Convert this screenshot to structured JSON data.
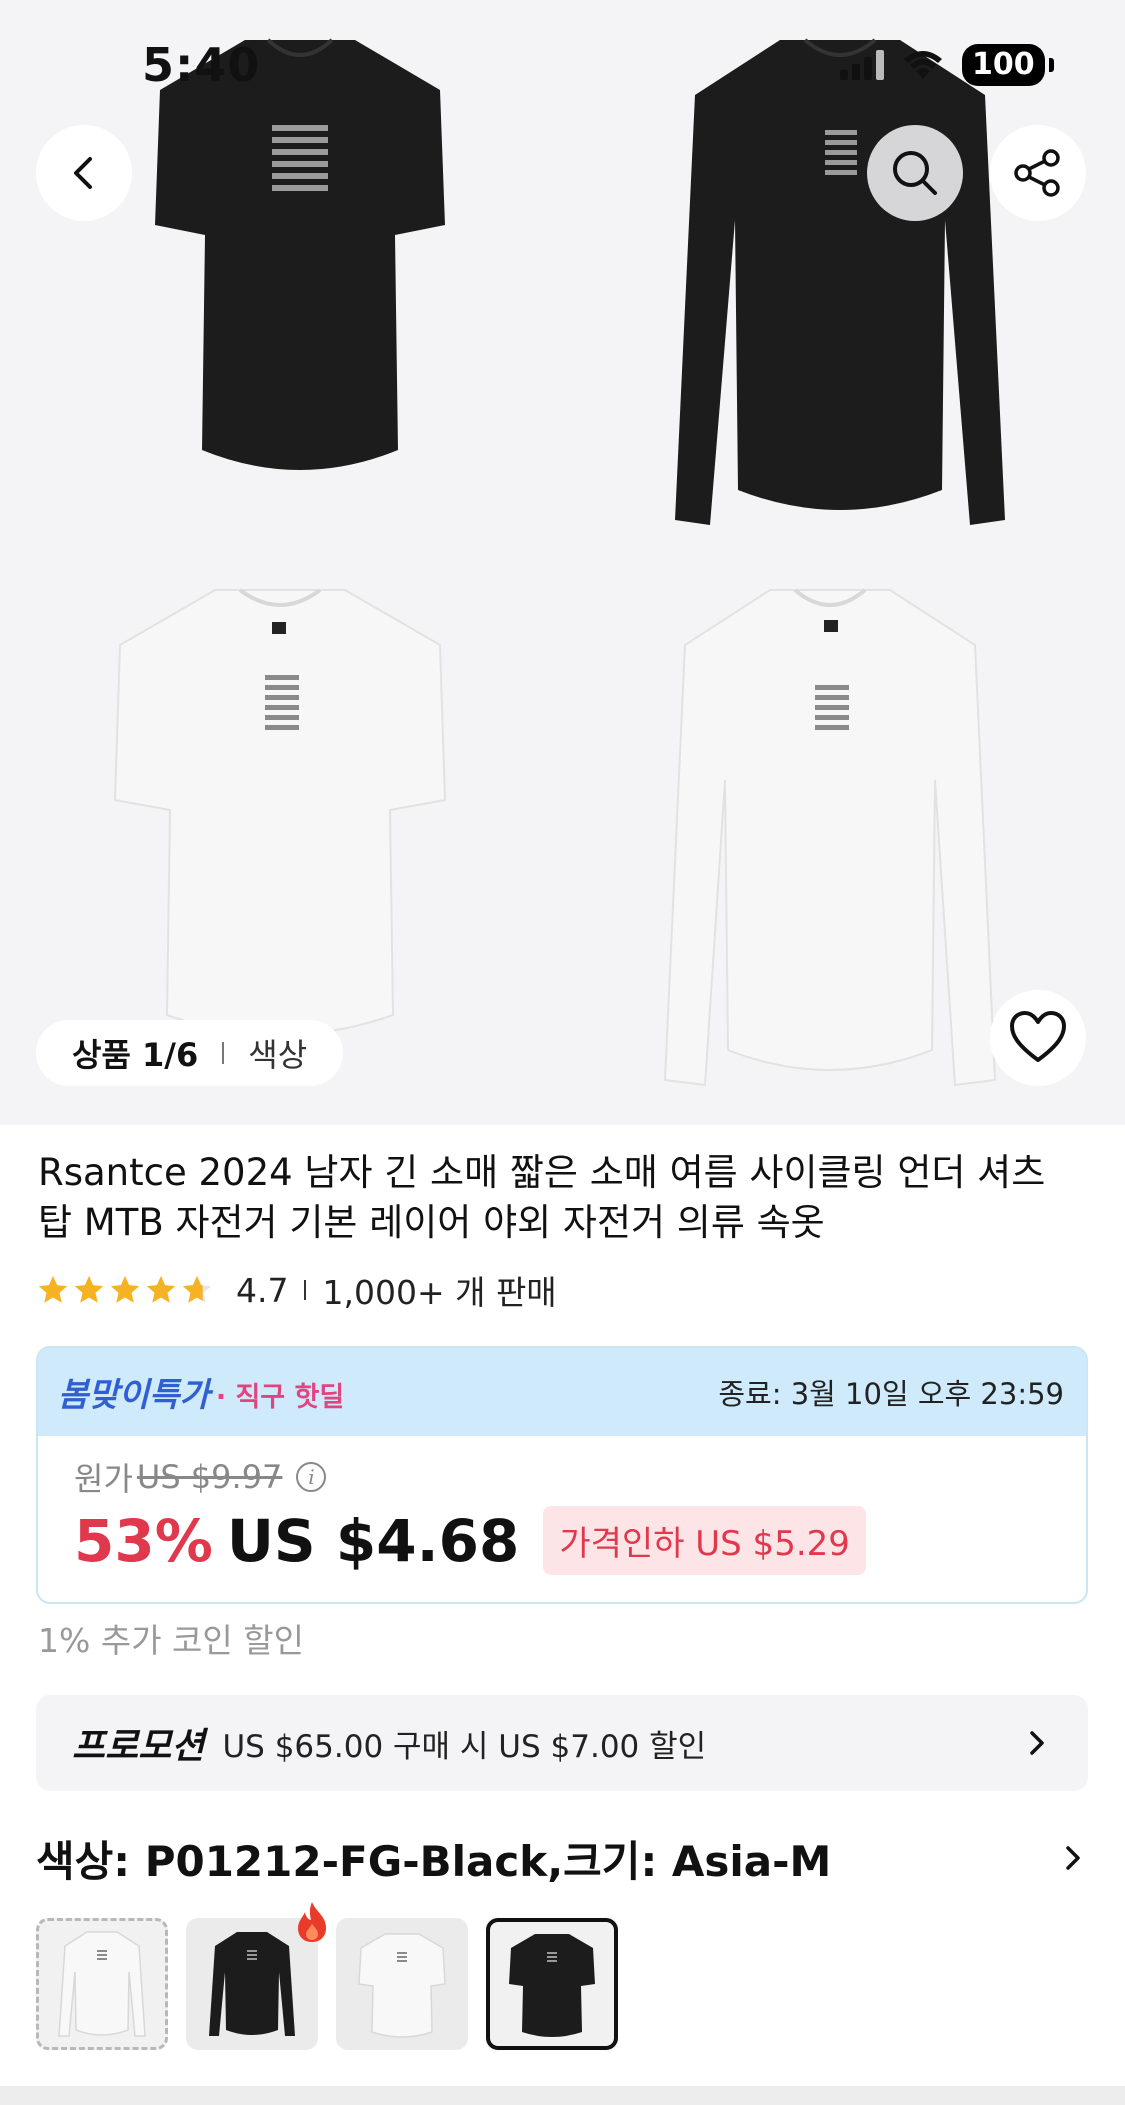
{
  "status_bar": {
    "time": "5:40",
    "battery": "100"
  },
  "gallery": {
    "counter": "상품 1/6",
    "category": "색상",
    "images": [
      {
        "name": "black short sleeve",
        "color": "#1c1c1c"
      },
      {
        "name": "black long sleeve",
        "color": "#1c1c1c"
      },
      {
        "name": "white short sleeve",
        "color": "#f7f7f7"
      },
      {
        "name": "white long sleeve",
        "color": "#f7f7f7"
      }
    ]
  },
  "icons": {
    "back": "chevron-left-icon",
    "search": "search-icon",
    "share": "share-icon",
    "wishlist": "heart-icon",
    "promo_arrow": "chevron-right-icon",
    "variant_arrow": "chevron-right-icon",
    "hot": "fire-icon"
  },
  "product": {
    "title": "Rsantce 2024 남자 긴 소매 짧은 소매 여름 사이클링 언더 셔츠 탑 MTB 자전거 기본 레이어 야외 자전거 의류 속옷",
    "rating": "4.7",
    "rating_value": 4.7,
    "sold": "1,000+ 개 판매"
  },
  "deal": {
    "brand": "봄맞이특가",
    "tag": "· 직구 핫딜",
    "ends": "종료: 3월 10일 오후 23:59",
    "original_label": "원가",
    "original_price": "US $9.97",
    "discount": "53%",
    "price": "US $4.68",
    "price_drop": "가격인하 US $5.29"
  },
  "coin_discount": "1% 추가 코인 할인",
  "promotion": {
    "label": "프로모션",
    "text": "US $65.00 구매 시 US $7.00 할인"
  },
  "variant": {
    "text": "색상: P01212-FG-Black,크기: Asia-M",
    "thumbs": [
      {
        "name": "white long sleeve",
        "selected": false
      },
      {
        "name": "black long sleeve",
        "selected": false,
        "hot": true
      },
      {
        "name": "white short sleeve",
        "selected": false
      },
      {
        "name": "black short sleeve",
        "selected": true
      }
    ]
  },
  "colors": {
    "accent_red": "#e0384c",
    "deal_blue": "#2f5fd0",
    "deal_pink": "#e0457f",
    "deal_header_bg": "#cfeafb",
    "star": "#f5b324"
  }
}
